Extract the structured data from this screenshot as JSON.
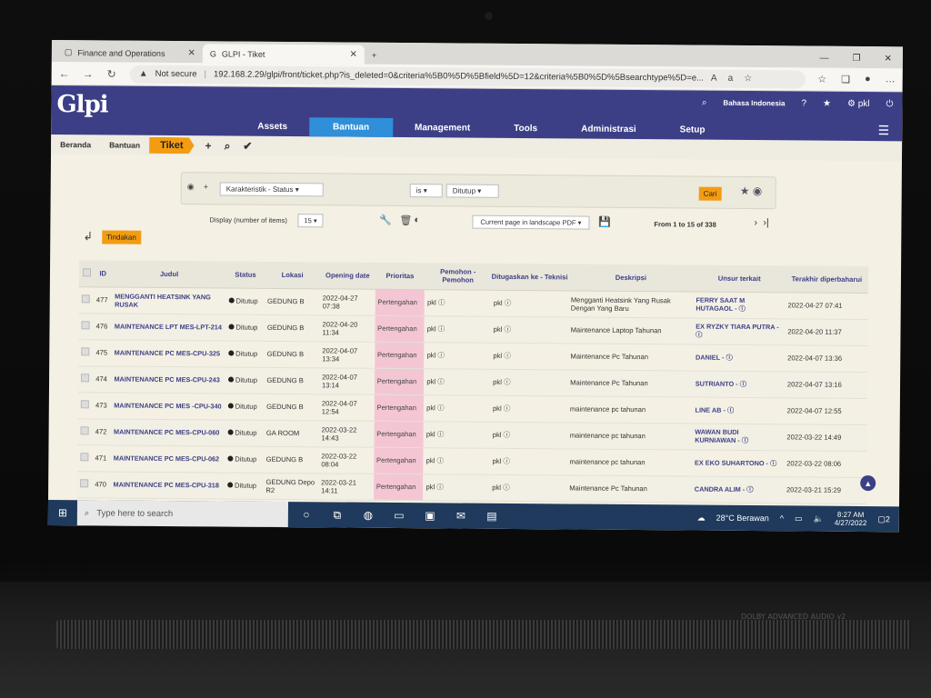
{
  "browser": {
    "tabs": [
      {
        "label": "Finance and Operations",
        "active": false
      },
      {
        "label": "GLPI - Tiket",
        "active": true
      }
    ],
    "new_tab": "+",
    "security": "Not secure",
    "url": "192.168.2.29/glpi/front/ticket.php?is_deleted=0&criteria%5B0%5D%5Bfield%5D=12&criteria%5B0%5D%5Bsearchtype%5D=e..."
  },
  "glpi": {
    "logo": "Glpi",
    "language": "Bahasa Indonesia",
    "user": "pkl",
    "menu": [
      "Assets",
      "Bantuan",
      "Management",
      "Tools",
      "Administrasi",
      "Setup"
    ],
    "menu_active": "Bantuan",
    "breadcrumb": [
      "Beranda",
      "Bantuan",
      "Tiket"
    ]
  },
  "search": {
    "field": "Karakteristik - Status",
    "operator": "is",
    "value": "Ditutup",
    "submit": "Cari"
  },
  "list": {
    "display_label": "Display (number of items)",
    "per_page": "15",
    "export": "Current page in landscape PDF",
    "pagination": "From 1 to 15 of 338",
    "actions_button": "Tindakan"
  },
  "table": {
    "headers": [
      "ID",
      "Judul",
      "Status",
      "Lokasi",
      "Opening date",
      "Prioritas",
      "Pemohon - Pemohon",
      "Ditugaskan ke - Teknisi",
      "Deskripsi",
      "Unsur terkait",
      "Terakhir diperbaharui"
    ],
    "rows": [
      {
        "id": "477",
        "judul": "MENGGANTI HEATSINK YANG RUSAK",
        "status": "Ditutup",
        "lokasi": "GEDUNG B",
        "opening": "2022-04-27 07:38",
        "prioritas": "Pertengahan",
        "pemohon": "pkl",
        "teknisi": "pkl",
        "deskripsi": "Mengganti Heatsink Yang Rusak Dengan Yang Baru",
        "unsur": "FERRY SAAT M HUTAGAOL",
        "updated": "2022-04-27 07:41"
      },
      {
        "id": "476",
        "judul": "MAINTENANCE LPT MES-LPT-214",
        "status": "Ditutup",
        "lokasi": "GEDUNG B",
        "opening": "2022-04-20 11:34",
        "prioritas": "Pertengahan",
        "pemohon": "pkl",
        "teknisi": "pkl",
        "deskripsi": "Maintenance Laptop Tahunan",
        "unsur": "EX RYZKY TIARA PUTRA",
        "updated": "2022-04-20 11:37"
      },
      {
        "id": "475",
        "judul": "MAINTENANCE PC MES-CPU-325",
        "status": "Ditutup",
        "lokasi": "GEDUNG B",
        "opening": "2022-04-07 13:34",
        "prioritas": "Pertengahan",
        "pemohon": "pkl",
        "teknisi": "pkl",
        "deskripsi": "Maintenance Pc Tahunan",
        "unsur": "DANIEL",
        "updated": "2022-04-07 13:36"
      },
      {
        "id": "474",
        "judul": "MAINTENANCE PC MES-CPU-243",
        "status": "Ditutup",
        "lokasi": "GEDUNG B",
        "opening": "2022-04-07 13:14",
        "prioritas": "Pertengahan",
        "pemohon": "pkl",
        "teknisi": "pkl",
        "deskripsi": "Maintenance Pc Tahunan",
        "unsur": "SUTRIANTO",
        "updated": "2022-04-07 13:16"
      },
      {
        "id": "473",
        "judul": "MAINTENANCE PC MES -CPU-340",
        "status": "Ditutup",
        "lokasi": "GEDUNG B",
        "opening": "2022-04-07 12:54",
        "prioritas": "Pertengahan",
        "pemohon": "pkl",
        "teknisi": "pkl",
        "deskripsi": "maintenance pc tahunan",
        "unsur": "LINE AB",
        "updated": "2022-04-07 12:55"
      },
      {
        "id": "472",
        "judul": "MAINTENANCE PC MES-CPU-060",
        "status": "Ditutup",
        "lokasi": "GA ROOM",
        "opening": "2022-03-22 14:43",
        "prioritas": "Pertengahan",
        "pemohon": "pkl",
        "teknisi": "pkl",
        "deskripsi": "maintenance pc tahunan",
        "unsur": "WAWAN BUDI KURNIAWAN",
        "updated": "2022-03-22 14:49"
      },
      {
        "id": "471",
        "judul": "MAINTENANCE PC MES-CPU-062",
        "status": "Ditutup",
        "lokasi": "GEDUNG B",
        "opening": "2022-03-22 08:04",
        "prioritas": "Pertengahan",
        "pemohon": "pkl",
        "teknisi": "pkl",
        "deskripsi": "maintenance pc tahunan",
        "unsur": "EX EKO SUHARTONO",
        "updated": "2022-03-22 08:06"
      },
      {
        "id": "470",
        "judul": "MAINTENANCE PC MES-CPU-318",
        "status": "Ditutup",
        "lokasi": "GEDUNG Depo R2",
        "opening": "2022-03-21 14:11",
        "prioritas": "Pertengahan",
        "pemohon": "pkl",
        "teknisi": "pkl",
        "deskripsi": "Maintenance Pc Tahunan",
        "unsur": "CANDRA ALIM",
        "updated": "2022-03-21 15:29"
      }
    ]
  },
  "taskbar": {
    "search_placeholder": "Type here to search",
    "weather": "28°C Berawan",
    "time": "8:27 AM",
    "date": "4/27/2022",
    "notifications": "2"
  },
  "bezel": {
    "brand": "DOLBY ADVANCED AUDIO v2"
  },
  "colors": {
    "header": "#3c3f86",
    "active_menu": "#2f8fd8",
    "accent": "#f39c12",
    "priority": "#f4c6d4"
  }
}
